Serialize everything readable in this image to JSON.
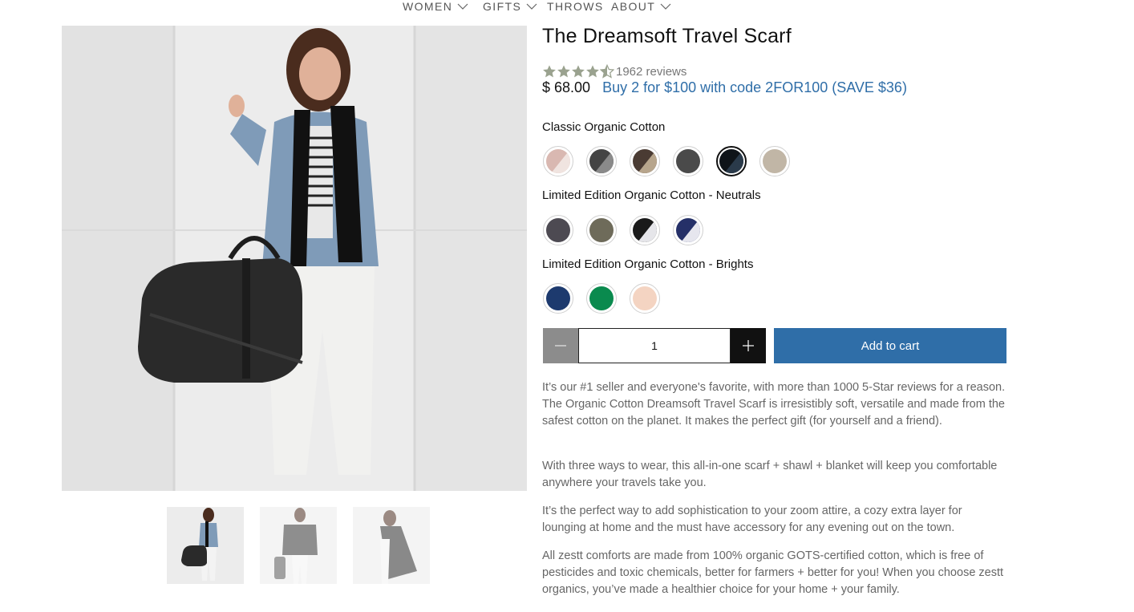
{
  "nav": {
    "items": [
      {
        "label": "WOMEN",
        "has_dropdown": true
      },
      {
        "label": "GIFTS",
        "has_dropdown": true
      },
      {
        "label": "THROWS",
        "has_dropdown": false
      },
      {
        "label": "ABOUT",
        "has_dropdown": true
      }
    ]
  },
  "product": {
    "title": "The Dreamsoft Travel Scarf",
    "rating": 4.5,
    "rating_color": "#9aa28f",
    "reviews_label": "1962 reviews",
    "price": "$ 68.00",
    "promo": "Buy 2 for $100 with code 2FOR100 (SAVE $36)",
    "promo_color": "#2f6ea8"
  },
  "options": [
    {
      "label": "Classic Organic Cotton",
      "swatches": [
        {
          "name": "blush",
          "colors": [
            "#d9b8b1",
            "#f0e4e0"
          ],
          "selected": false
        },
        {
          "name": "charcoal-grey",
          "colors": [
            "#444444",
            "#8a8a8a"
          ],
          "selected": false
        },
        {
          "name": "espresso-taupe",
          "colors": [
            "#4a3b33",
            "#b7a58c"
          ],
          "selected": false
        },
        {
          "name": "graphite",
          "colors": [
            "#4a4a4a",
            "#4a4a4a"
          ],
          "selected": false
        },
        {
          "name": "black",
          "colors": [
            "#0f1419",
            "#2a3a4a"
          ],
          "selected": true
        },
        {
          "name": "oatmeal",
          "colors": [
            "#c1b6a6",
            "#c1b6a6"
          ],
          "selected": false
        }
      ]
    },
    {
      "label": "Limited Edition Organic Cotton - Neutrals",
      "swatches": [
        {
          "name": "slate",
          "colors": [
            "#4d4a52",
            "#4d4a52"
          ],
          "selected": false
        },
        {
          "name": "olive",
          "colors": [
            "#6e6b5a",
            "#6e6b5a"
          ],
          "selected": false
        },
        {
          "name": "black-white",
          "colors": [
            "#1a1a1a",
            "#e6e6ea"
          ],
          "selected": false
        },
        {
          "name": "navy-white",
          "colors": [
            "#253068",
            "#e6e6ee"
          ],
          "selected": false
        }
      ]
    },
    {
      "label": "Limited Edition Organic Cotton - Brights",
      "swatches": [
        {
          "name": "navy",
          "colors": [
            "#1d3a6e",
            "#1d3a6e"
          ],
          "selected": false
        },
        {
          "name": "green",
          "colors": [
            "#0a8a4e",
            "#0a8a4e"
          ],
          "selected": false
        },
        {
          "name": "peach",
          "colors": [
            "#f4d4c2",
            "#f4d4c2"
          ],
          "selected": false
        }
      ]
    }
  ],
  "cart": {
    "quantity": "1",
    "add_label": "Add to cart"
  },
  "description": [
    "It’s our #1 seller and everyone's favorite, with more than 1000 5-Star reviews for a reason. The Organic Cotton Dreamsoft Travel Scarf is irresistibly soft, versatile and made from the safest cotton on the planet. It makes the perfect gift (for yourself and a friend).",
    "With three ways to wear, this all-in-one scarf + shawl + blanket will keep you comfortable anywhere your travels take you.",
    "It’s the perfect way to add sophistication to your zoom attire, a cozy extra layer for lounging at home and the must have accessory for any evening out on the town.",
    "All zestt comforts are made from 100% organic GOTS-certified cotton, which is free of pesticides and toxic chemicals, better for farmers + better for you! When you choose zestt organics, you’ve made a healthier choice for your home + your family."
  ],
  "gallery": {
    "thumbnails": [
      {
        "name": "thumbnail-front-bag",
        "selected": true
      },
      {
        "name": "thumbnail-shawl",
        "selected": false
      },
      {
        "name": "thumbnail-draped",
        "selected": false
      }
    ]
  }
}
